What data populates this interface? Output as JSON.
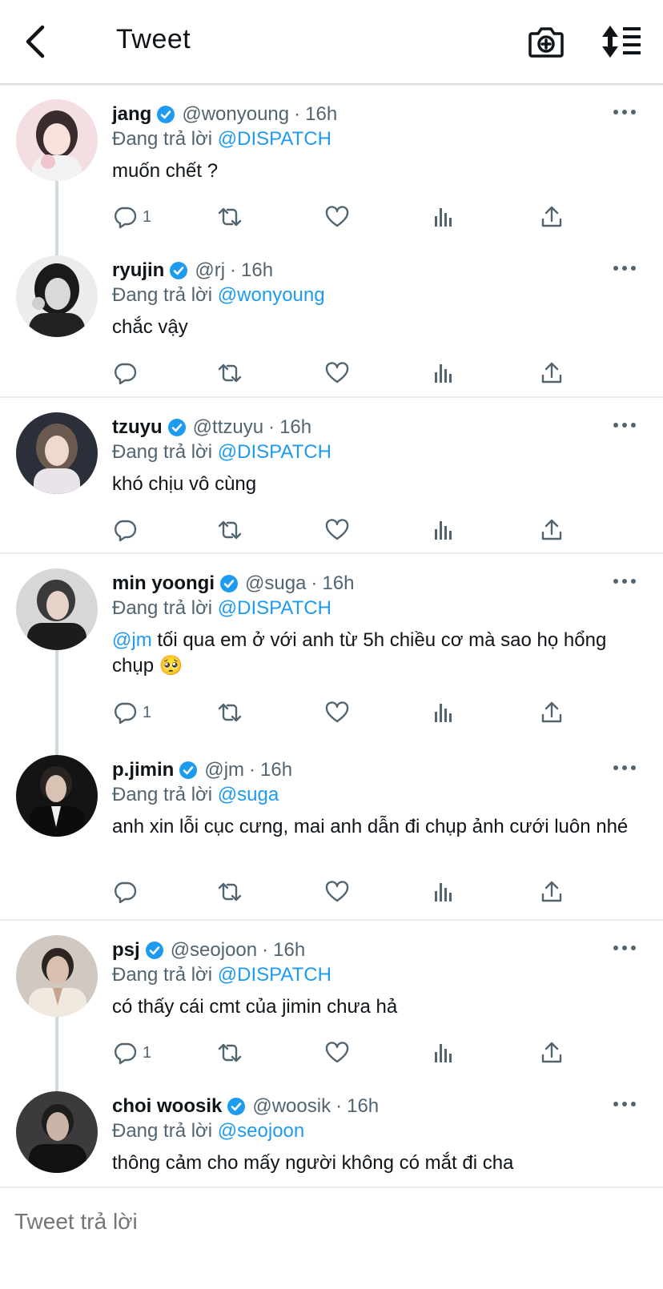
{
  "header": {
    "title": "Tweet"
  },
  "reply_bar": {
    "placeholder": "Tweet trả lời"
  },
  "tweets": [
    {
      "name": "jang",
      "handle": "@wonyoung",
      "sep": "·",
      "time": "16h",
      "reply_prefix": "Đang trả lời",
      "reply_to": "@DISPATCH",
      "text": "muốn chết ?",
      "reply_count": "1"
    },
    {
      "name": "ryujin",
      "handle": "@rj",
      "sep": "·",
      "time": "16h",
      "reply_prefix": "Đang trả lời",
      "reply_to": "@wonyoung",
      "text": "chắc vậy",
      "reply_count": ""
    },
    {
      "name": "tzuyu",
      "handle": "@ttzuyu",
      "sep": "·",
      "time": "16h",
      "reply_prefix": "Đang trả lời",
      "reply_to": "@DISPATCH",
      "text": "khó chịu vô cùng",
      "reply_count": ""
    },
    {
      "name": "min yoongi",
      "handle": "@suga",
      "sep": "·",
      "time": "16h",
      "reply_prefix": "Đang trả lời",
      "reply_to": "@DISPATCH",
      "text_mention": "@jm",
      "text": " tối qua em ở với anh từ 5h chiều cơ mà sao họ hổng chụp 🥺",
      "reply_count": "1"
    },
    {
      "name": "p.jimin",
      "handle": "@jm",
      "sep": "·",
      "time": "16h",
      "reply_prefix": "Đang trả lời",
      "reply_to": "@suga",
      "text": "anh xin lỗi cục cưng, mai anh dẫn đi chụp ảnh cưới luôn nhé",
      "reply_count": ""
    },
    {
      "name": "psj",
      "handle": "@seojoon",
      "sep": "·",
      "time": "16h",
      "reply_prefix": "Đang trả lời",
      "reply_to": "@DISPATCH",
      "text": "có thấy cái cmt của jimin chưa hả",
      "reply_count": "1"
    },
    {
      "name": "choi woosik",
      "handle": "@woosik",
      "sep": "·",
      "time": "16h",
      "reply_prefix": "Đang trả lời",
      "reply_to": "@seojoon",
      "text": "thông cảm cho mấy người không có mắt đi cha",
      "reply_count": ""
    }
  ],
  "colors": {
    "accent": "#1d9bf0",
    "muted": "#536471",
    "divider": "#e6ecf0"
  },
  "icons": [
    "back-arrow-icon",
    "camera-plus-icon",
    "sort-icon",
    "verified-icon",
    "more-icon",
    "reply-icon",
    "retweet-icon",
    "like-icon",
    "views-icon",
    "share-icon"
  ]
}
